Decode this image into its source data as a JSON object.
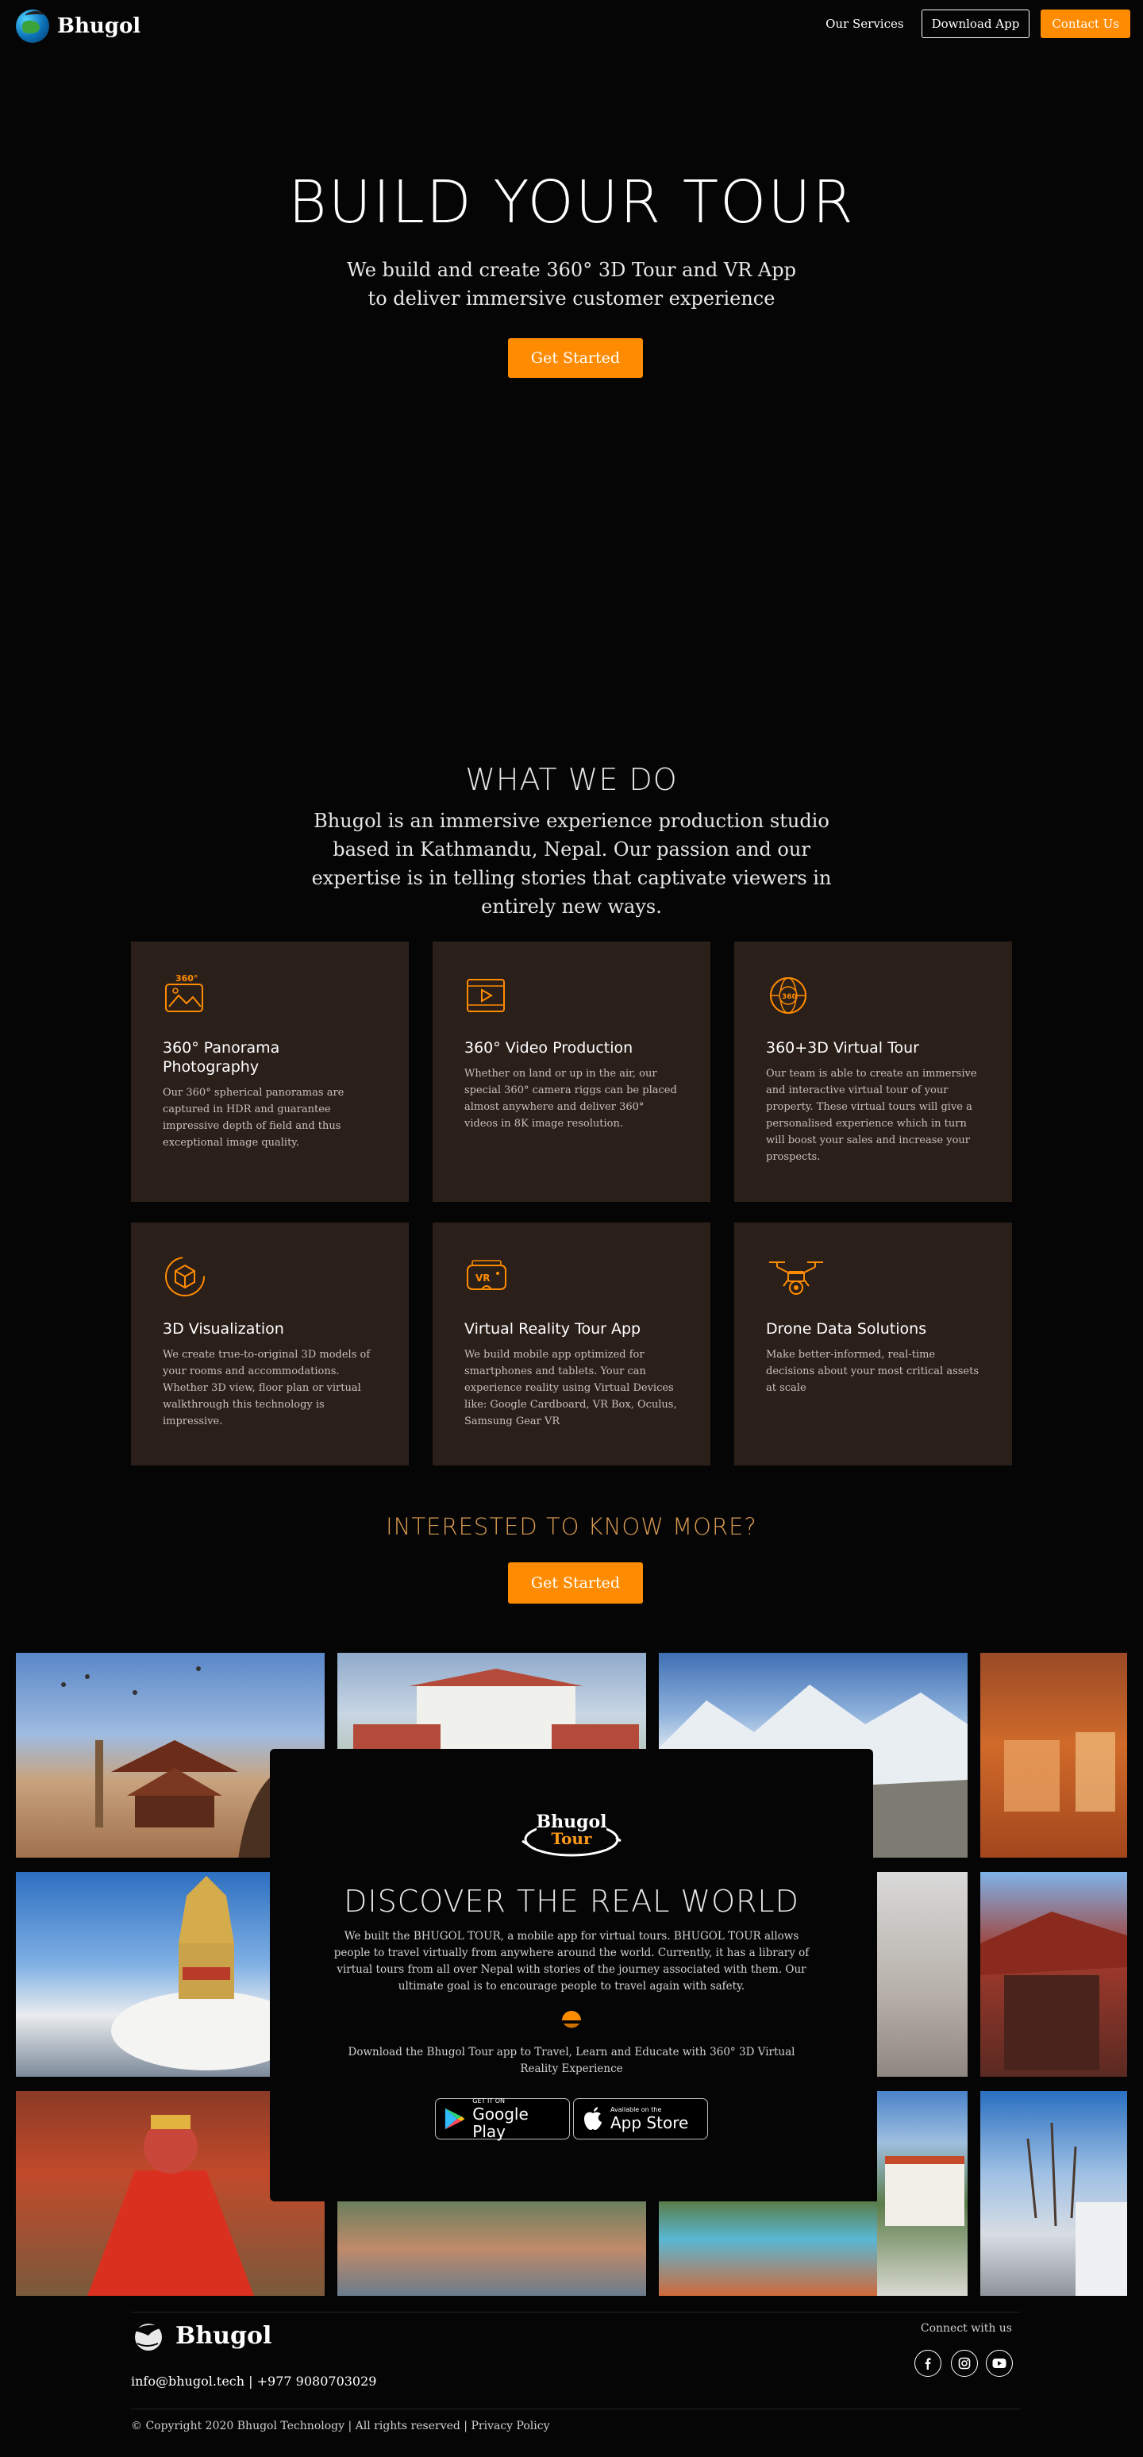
{
  "header": {
    "brand": "Bhugol",
    "nav_services": "Our Services",
    "nav_download": "Download App",
    "nav_contact": "Contact Us"
  },
  "hero": {
    "title": "BUILD YOUR TOUR",
    "subtitle_line1": "We build and create 360° 3D Tour and VR App",
    "subtitle_line2": "to deliver immersive customer experience",
    "cta": "Get Started"
  },
  "what_we_do": {
    "title": "WHAT WE DO",
    "description": "Bhugol is an immersive experience production studio based in Kathmandu, Nepal. Our passion and our expertise is in telling stories that captivate viewers in entirely new ways.",
    "services": [
      {
        "icon": "panorama-360-icon",
        "title": "360° Panorama Photography",
        "text": "Our 360° spherical panoramas are captured in HDR and guarantee impressive depth of field and thus exceptional image quality."
      },
      {
        "icon": "video-play-icon",
        "title": "360° Video Production",
        "text": "Whether on land or up in the air, our special 360° camera riggs can be placed almost anywhere and deliver 360° videos in 8K image resolution."
      },
      {
        "icon": "globe-360-icon",
        "title": "360+3D Virtual Tour",
        "text": "Our team is able to create an immersive and interactive virtual tour of your property. These virtual tours will give a personalised experience which in turn will boost your sales and increase your prospects."
      },
      {
        "icon": "cube-3d-icon",
        "title": "3D Visualization",
        "text": "We create true-to-original 3D models of your rooms and accommodations. Whether 3D view, floor plan or virtual walkthrough this technology is impressive."
      },
      {
        "icon": "vr-headset-icon",
        "title": "Virtual Reality Tour App",
        "text": "We build mobile app optimized for smartphones and tablets. Your can experience reality using Virtual Devices like: Google Cardboard, VR Box, Oculus, Samsung Gear VR"
      },
      {
        "icon": "drone-icon",
        "title": "Drone Data Solutions",
        "text": "Make better-informed, real-time decisions about your most critical assets at scale"
      }
    ],
    "more_title": "INTERESTED TO KNOW MORE?",
    "more_cta": "Get Started"
  },
  "discover": {
    "logo_line1": "Bhugol",
    "logo_line2": "Tour",
    "title": "DISCOVER THE REAL WORLD",
    "description": "We built the BHUGOL TOUR, a mobile app for virtual tours. BHUGOL TOUR allows people to travel virtually from anywhere around the world. Currently, it has a library of virtual tours from all over Nepal with stories of the journey associated with them. Our ultimate goal is to encourage people to travel again with safety.",
    "cta_text": "Download the Bhugol Tour app to Travel, Learn and Educate with 360° 3D Virtual Reality Experience",
    "google_small": "GET IT ON",
    "google_big": "Google Play",
    "apple_small": "Available on the",
    "apple_big": "App Store"
  },
  "footer": {
    "brand": "Bhugol",
    "contact": "info@bhugol.tech | +977 9080703029",
    "connect": "Connect with us",
    "copyright": "© Copyright 2020 Bhugol Technology | All rights reserved | Privacy Policy"
  },
  "colors": {
    "accent": "#ff8c00",
    "card_bg": "#2b1f1a",
    "background": "#050505"
  }
}
